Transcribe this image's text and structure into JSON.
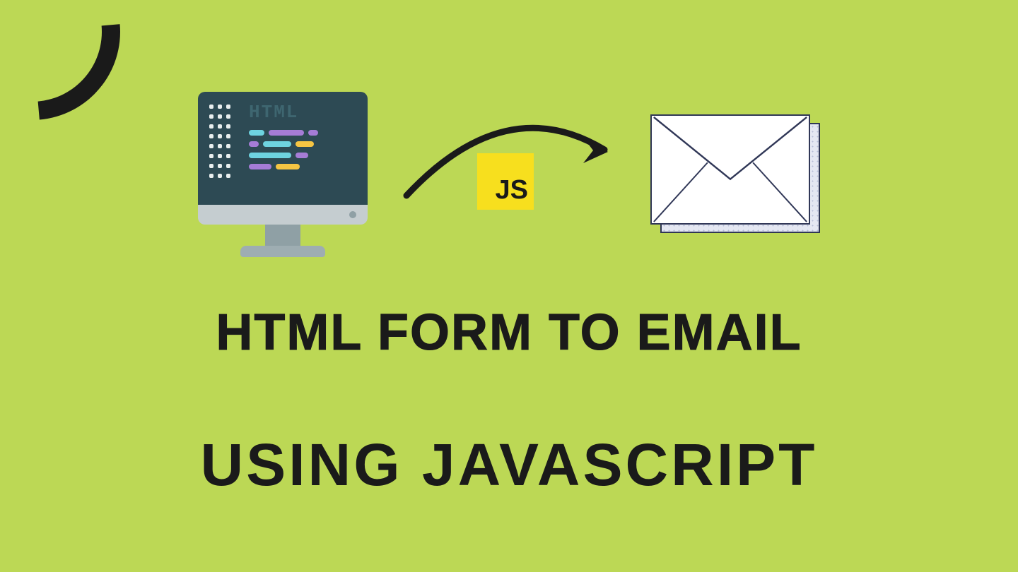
{
  "computer": {
    "screen_label": "HTML"
  },
  "js_badge": {
    "label": "JS"
  },
  "heading_main": "HTML FORM TO EMAIL",
  "heading_sub": "USING JAVASCRIPT"
}
